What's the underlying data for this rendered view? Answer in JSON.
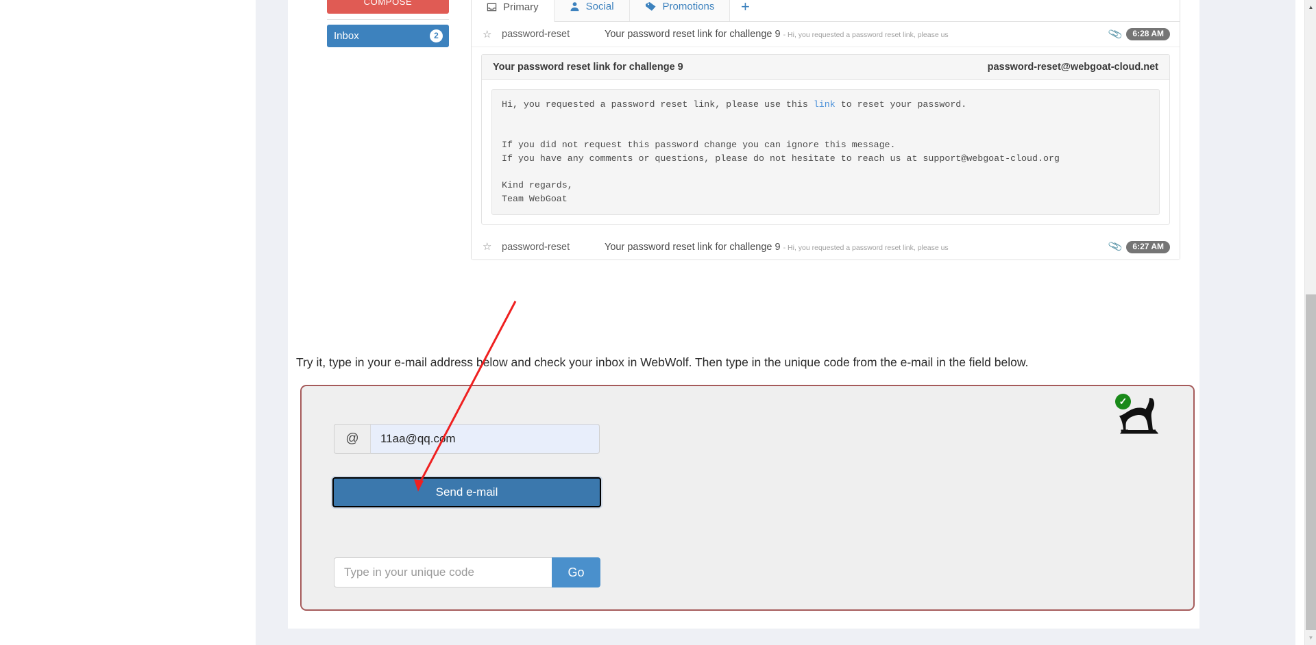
{
  "mail": {
    "sidebar": {
      "compose_label": "COMPOSE",
      "inbox_label": "Inbox",
      "inbox_count": "2"
    },
    "tabs": [
      {
        "label": "Primary",
        "icon": "inbox-icon",
        "active": true
      },
      {
        "label": "Social",
        "icon": "person-icon",
        "active": false
      },
      {
        "label": "Promotions",
        "icon": "tag-icon",
        "active": false
      }
    ],
    "add_tab_label": "+",
    "rows": [
      {
        "sender": "password-reset",
        "subject": "Your password reset link for challenge 9",
        "snippet": "- Hi, you requested a password reset link, please us",
        "time": "6:28 AM"
      },
      {
        "sender": "password-reset",
        "subject": "Your password reset link for challenge 9",
        "snippet": "- Hi, you requested a password reset link, please us",
        "time": "6:27 AM"
      }
    ],
    "detail": {
      "title": "Your password reset link for challenge 9",
      "from": "password-reset@webgoat-cloud.net",
      "body_line1_pre": "Hi, you requested a password reset link, please use this ",
      "body_link": "link",
      "body_line1_post": " to reset your password.",
      "body_rest": "\n\n\nIf you did not request this password change you can ignore this message.\nIf you have any comments or questions, please do not hesitate to reach us at support@webgoat-cloud.org\n\nKind regards,\nTeam WebGoat"
    }
  },
  "lesson": {
    "instruction": "Try it, type in your e-mail address below and check your inbox in WebWolf. Then type in the unique code from the e-mail in the field below."
  },
  "assignment": {
    "email_addon": "@",
    "email_value": "11aa@qq.com",
    "email_placeholder": "",
    "send_label": "Send e-mail",
    "code_value": "",
    "code_placeholder": "Type in your unique code",
    "go_label": "Go",
    "status_icon": "check-circle-icon",
    "logo_icon": "wolf-icon"
  },
  "colors": {
    "compose_red": "#e05b54",
    "inbox_blue": "#3d82be",
    "send_blue": "#3b78ad",
    "go_blue": "#4a90cc",
    "form_border": "#a55a5a",
    "check_green": "#1a8a1a",
    "annotation_red": "#ef2020"
  }
}
